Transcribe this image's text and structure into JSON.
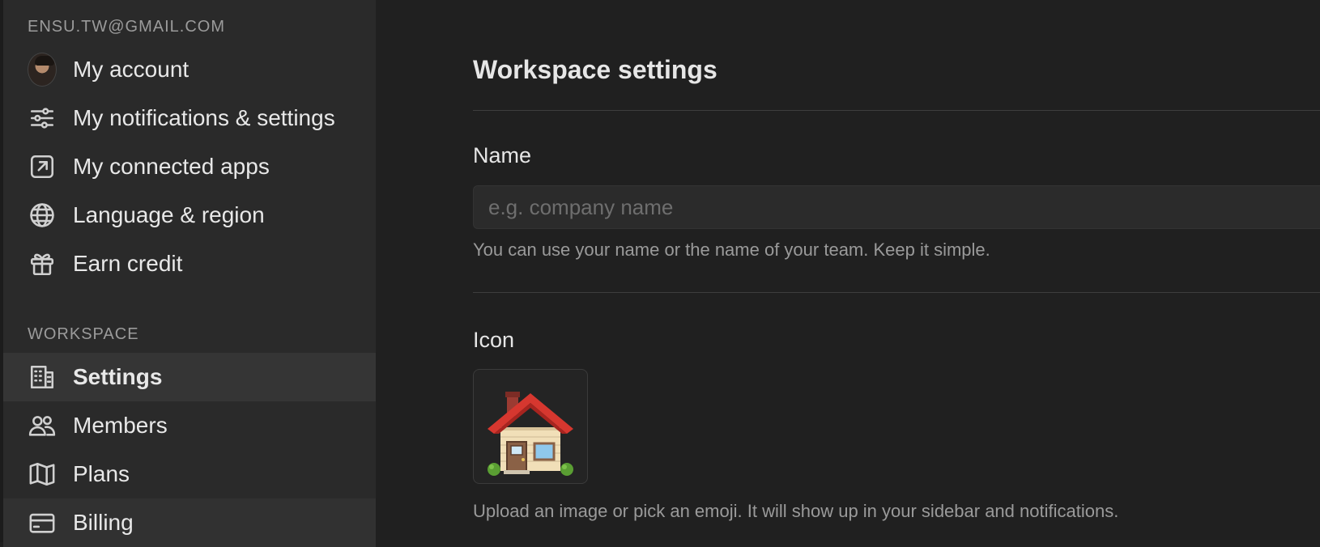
{
  "sidebar": {
    "account_email": "ENSU.TW@GMAIL.COM",
    "account_items": [
      {
        "label": "My account",
        "icon": "avatar"
      },
      {
        "label": "My notifications & settings",
        "icon": "sliders-icon"
      },
      {
        "label": "My connected apps",
        "icon": "external-link-icon"
      },
      {
        "label": "Language & region",
        "icon": "globe-icon"
      },
      {
        "label": "Earn credit",
        "icon": "gift-icon"
      }
    ],
    "workspace_header": "WORKSPACE",
    "workspace_items": [
      {
        "label": "Settings",
        "icon": "building-icon",
        "active": true
      },
      {
        "label": "Members",
        "icon": "people-icon"
      },
      {
        "label": "Plans",
        "icon": "map-icon"
      },
      {
        "label": "Billing",
        "icon": "credit-card-icon"
      }
    ]
  },
  "main": {
    "title": "Workspace settings",
    "name": {
      "label": "Name",
      "value": "",
      "placeholder": "e.g. company name",
      "help": "You can use your name or the name of your team. Keep it simple."
    },
    "icon": {
      "label": "Icon",
      "current": "house-emoji",
      "help": "Upload an image or pick an emoji. It will show up in your sidebar and notifications."
    }
  },
  "colors": {
    "sidebar_bg": "#2a2a2a",
    "main_bg": "#202020",
    "active_item_bg": "#353535",
    "text_primary": "#e6e6e6",
    "text_muted": "#9a9a9a"
  }
}
